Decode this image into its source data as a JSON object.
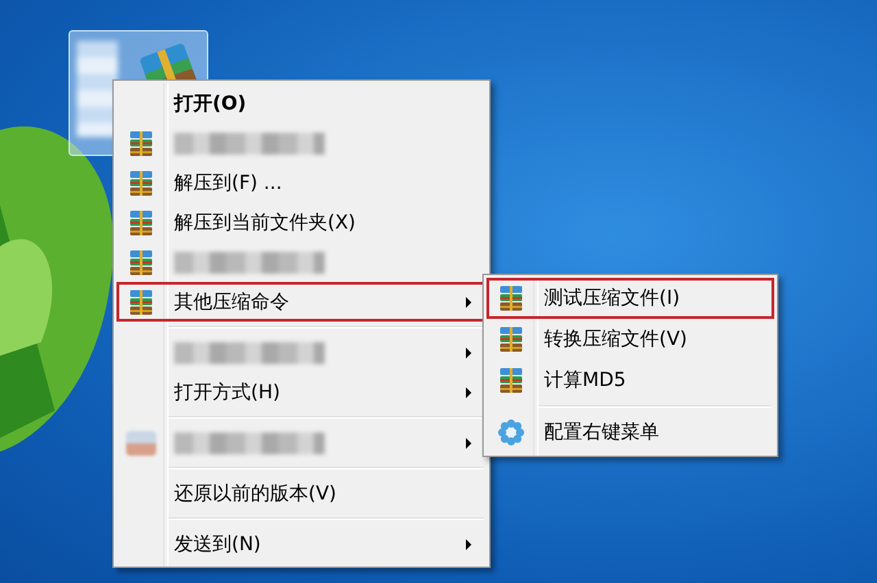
{
  "desktop": {
    "icon": {
      "selected": true
    }
  },
  "menu": {
    "items": [
      {
        "kind": "plain",
        "label": "打开(O)",
        "bold": true,
        "has_submenu": false,
        "highlighted": false
      },
      {
        "kind": "maskedarchive",
        "has_submenu": false,
        "highlighted": false
      },
      {
        "kind": "archive",
        "label": "解压到(F) ...",
        "has_submenu": false,
        "highlighted": false
      },
      {
        "kind": "archive",
        "label": "解压到当前文件夹(X)",
        "has_submenu": false,
        "highlighted": false
      },
      {
        "kind": "maskedarchive",
        "has_submenu": false,
        "highlighted": false
      },
      {
        "kind": "archive",
        "label": "其他压缩命令",
        "has_submenu": true,
        "highlighted": true
      },
      {
        "kind": "separator"
      },
      {
        "kind": "masked",
        "has_submenu": true,
        "highlighted": false
      },
      {
        "kind": "plain",
        "label": "打开方式(H)",
        "has_submenu": true,
        "highlighted": false
      },
      {
        "kind": "separator"
      },
      {
        "kind": "maskedapp",
        "has_submenu": true,
        "highlighted": false
      },
      {
        "kind": "separator"
      },
      {
        "kind": "plain",
        "label": "还原以前的版本(V)",
        "has_submenu": false,
        "highlighted": false
      },
      {
        "kind": "separator"
      },
      {
        "kind": "plain",
        "label": "发送到(N)",
        "has_submenu": true,
        "highlighted": false
      }
    ]
  },
  "submenu": {
    "items": [
      {
        "kind": "archive",
        "label": "测试压缩文件(I)",
        "has_submenu": false,
        "highlighted": true
      },
      {
        "kind": "archive",
        "label": "转换压缩文件(V)",
        "has_submenu": false,
        "highlighted": false
      },
      {
        "kind": "archive",
        "label": "计算MD5",
        "has_submenu": false,
        "highlighted": false
      },
      {
        "kind": "separator"
      },
      {
        "kind": "gear",
        "label": "配置右键菜单",
        "has_submenu": false,
        "highlighted": false
      }
    ]
  }
}
